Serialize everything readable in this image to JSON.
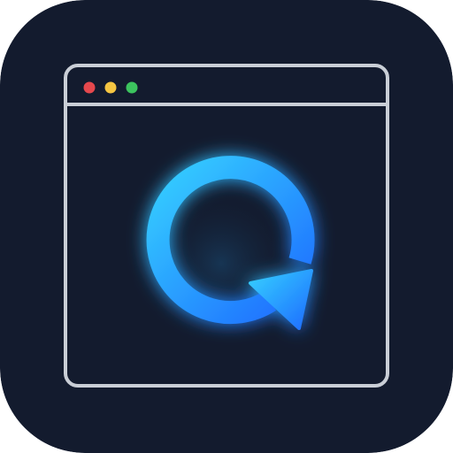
{
  "app_icon": {
    "name": "browser-refresh-app-icon",
    "icon_names": [
      "browser-window-icon",
      "refresh-arrow-icon"
    ],
    "colors": {
      "background": "#131B2E",
      "window_outline": "#C9CED6",
      "dot_close": "#E5484D",
      "dot_minimize": "#F5C542",
      "dot_maximize": "#3CC35E",
      "refresh_light": "#35D0FF",
      "refresh_dark": "#1E6BFF"
    }
  }
}
